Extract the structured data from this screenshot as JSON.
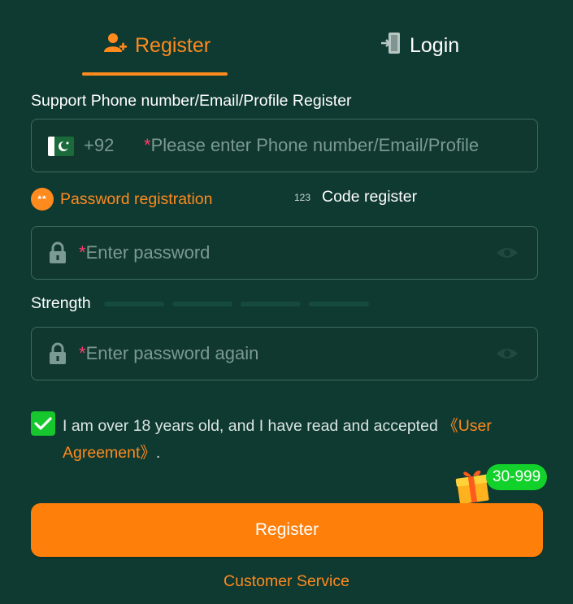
{
  "tabs": {
    "register": {
      "label": "Register",
      "icon": "user-plus-icon"
    },
    "login": {
      "label": "Login",
      "icon": "login-door-icon"
    }
  },
  "form": {
    "account_label": "Support Phone number/Email/Profile Register",
    "country_code": "+92",
    "account_placeholder": "Please enter Phone number/Email/Profile",
    "required_mark": "*",
    "modes": {
      "password": {
        "label": "Password registration",
        "icon_text": "**"
      },
      "code": {
        "label": "Code register",
        "icon_text": "123"
      }
    },
    "password_placeholder": "Enter password",
    "strength_label": "Strength",
    "confirm_placeholder": "Enter password again"
  },
  "agreement": {
    "checked": true,
    "text": "I am over 18 years old, and I have read and accepted ",
    "link_text": "《User Agreement》",
    "end": "."
  },
  "gift": {
    "badge": "30-999"
  },
  "submit_label": "Register",
  "customer_service": "Customer Service",
  "colors": {
    "background": "#0f3a31",
    "accent": "#ff8a1e",
    "button": "#ff7f0b",
    "check": "#16c72d",
    "required": "#ff3d72"
  }
}
